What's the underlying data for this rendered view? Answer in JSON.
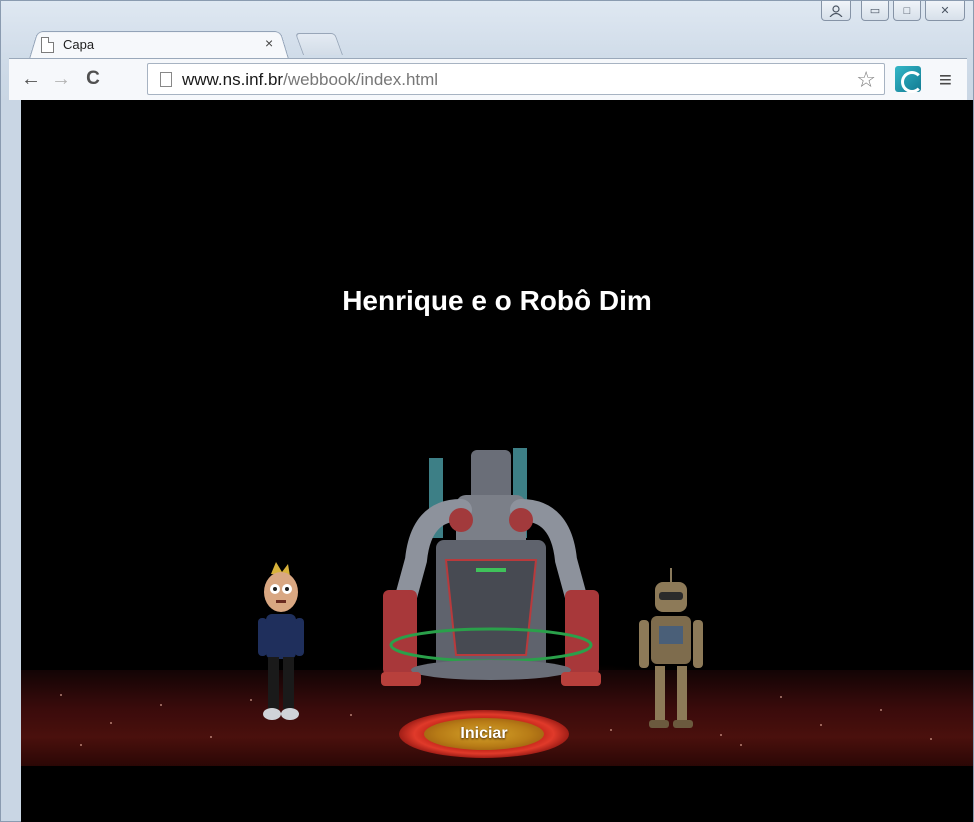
{
  "browser": {
    "tab": {
      "title": "Capa",
      "close_glyph": "×"
    },
    "toolbar": {
      "back_glyph": "←",
      "forward_glyph": "→",
      "reload_glyph": "C",
      "url_host": "www.ns.inf.br",
      "url_path": "/webbook/index.html",
      "star_glyph": "☆",
      "menu_glyph": "≡"
    },
    "window": {
      "minimize_glyph": "▭",
      "maximize_glyph": "□",
      "close_glyph": "✕"
    }
  },
  "page": {
    "title": "Henrique e o Robô Dim",
    "start_button_label": "Iniciar"
  },
  "colors": {
    "scene_background": "#000000",
    "floor": "#3a0b0b",
    "button_ring": "#c22418",
    "button_fill": "#b77b16"
  }
}
